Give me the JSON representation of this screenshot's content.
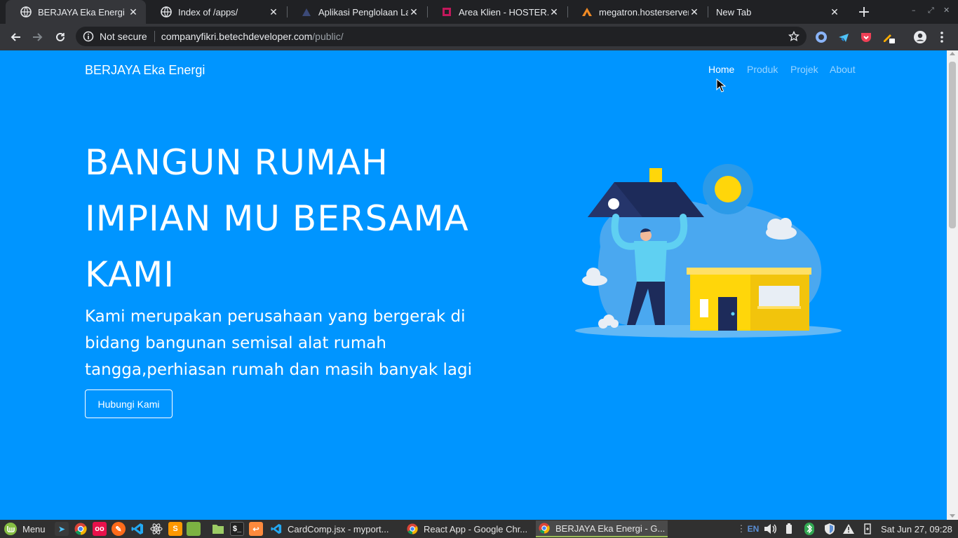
{
  "browser": {
    "tabs": [
      {
        "title": "BERJAYA Eka Energi",
        "icon": "globe-icon",
        "active": true
      },
      {
        "title": "Index of /apps/",
        "icon": "globe-icon",
        "active": false
      },
      {
        "title": "Aplikasi Penglolaan La",
        "icon": "triangle-logo-icon",
        "active": false
      },
      {
        "title": "Area Klien - HOSTER.CO",
        "icon": "hoster-logo-icon",
        "active": false
      },
      {
        "title": "megatron.hosterserver",
        "icon": "cpanel-logo-icon",
        "active": false
      },
      {
        "title": "New Tab",
        "icon": "",
        "active": false
      }
    ],
    "omnibox": {
      "security_label": "Not secure",
      "url_host": "companyfikri.betechdeveloper.com",
      "url_path": "/public/"
    }
  },
  "page": {
    "navbar": {
      "brand": "BERJAYA Eka Energi",
      "links": [
        "Home",
        "Produk",
        "Projek",
        "About"
      ],
      "active_link": "Home"
    },
    "hero": {
      "title_lines": [
        "BANGUN RUMAH",
        "IMPIAN MU BERSAMA",
        "KAMI"
      ],
      "description": "Kami merupakan perusahaan yang bergerak di bidang bangunan semisal alat rumah tangga,perhiasan rumah dan masih banyak lagi",
      "cta_label": "Hubungi Kami",
      "illustration": "person-lifting-house-roof-illustration"
    },
    "colors": {
      "background": "#0095ff",
      "text": "#ffffff"
    }
  },
  "taskbar": {
    "menu_label": "Menu",
    "windows": [
      {
        "title": "CardComp.jsx - myport...",
        "icon": "vscode-icon",
        "active": false
      },
      {
        "title": "React App - Google Chr...",
        "icon": "chrome-icon",
        "active": false
      },
      {
        "title": "BERJAYA Eka Energi - G...",
        "icon": "chrome-icon",
        "active": true
      }
    ],
    "keyboard_layout": "EN",
    "clock": "Sat Jun 27, 09:28"
  }
}
